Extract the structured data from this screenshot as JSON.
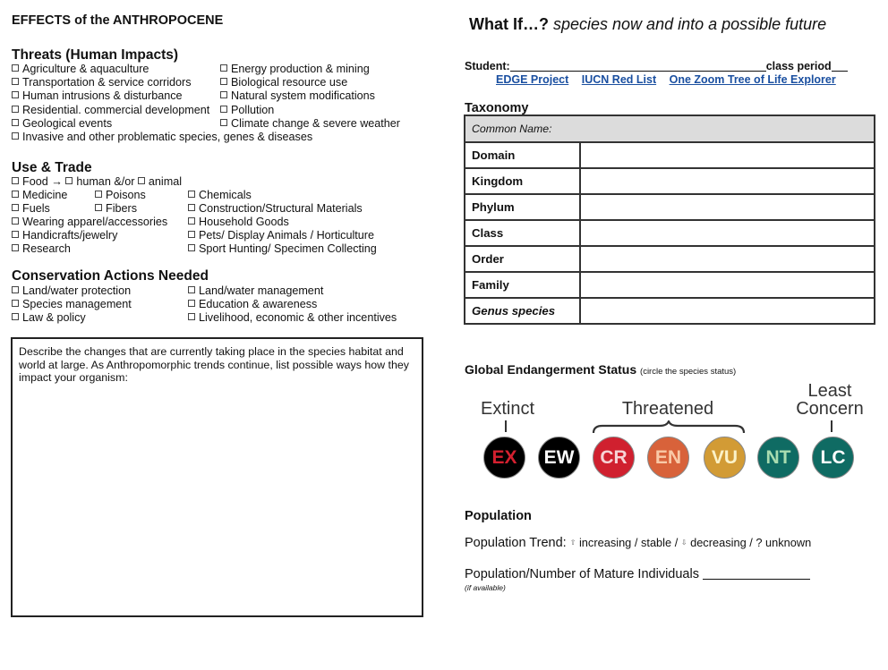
{
  "left": {
    "title": "EFFECTS of the ANTHROPOCENE",
    "threats": {
      "heading": "Threats (Human Impacts)",
      "rows": [
        [
          "Agriculture & aquaculture",
          "Energy production & mining"
        ],
        [
          "Transportation & service corridors",
          "Biological resource use"
        ],
        [
          "Human intrusions & disturbance",
          "Natural system modifications"
        ],
        [
          "Residential. commercial development",
          "Pollution"
        ],
        [
          "Geological events",
          "Climate change & severe weather"
        ],
        [
          "Invasive and other problematic species, genes & diseases"
        ]
      ]
    },
    "use_trade": {
      "heading": "Use & Trade",
      "food": {
        "label": "Food",
        "arrow": "→",
        "human": "human &/or",
        "animal": "animal"
      },
      "rows": [
        [
          "Medicine",
          "Poisons",
          "Chemicals"
        ],
        [
          "Fuels",
          "Fibers",
          "Construction/Structural Materials"
        ],
        [
          "Wearing apparel/accessories",
          "Household Goods"
        ],
        [
          "Handicrafts/jewelry",
          "Pets/ Display Animals / Horticulture"
        ],
        [
          "Research",
          "Sport Hunting/ Specimen Collecting"
        ]
      ]
    },
    "conservation": {
      "heading": "Conservation Actions Needed",
      "rows": [
        [
          "Land/water protection",
          "Land/water management"
        ],
        [
          "Species management",
          "Education & awareness"
        ],
        [
          "Law & policy",
          "Livelihood, economic & other incentives"
        ]
      ]
    },
    "describe_prompt": "Describe the changes that are currently taking place in the species habitat and world at large. As Anthropomorphic trends continue, list possible ways how they impact your organism:"
  },
  "right": {
    "title_bold": "What If…?",
    "title_italic": "species now and into a possible future",
    "student_label": "Student:",
    "class_period_label": "class period",
    "links": [
      "EDGE Project",
      "IUCN Red List",
      "One Zoom Tree of Life Explorer"
    ],
    "link_color": "#1a4fa0",
    "taxonomy": {
      "heading": "Taxonomy",
      "common_name_label": "Common Name:",
      "rows": [
        "Domain",
        "Kingdom",
        "Phylum",
        "Class",
        "Order",
        "Family",
        "Genus species"
      ]
    },
    "status": {
      "heading": "Global Endangerment Status",
      "note": "(circle the species status)",
      "groups": {
        "extinct": "Extinct",
        "threatened": "Threatened",
        "least": "Least",
        "concern": "Concern"
      },
      "codes": [
        {
          "code": "EX",
          "bg": "#000000",
          "fg": "#d4202f"
        },
        {
          "code": "EW",
          "bg": "#000000",
          "fg": "#ffffff"
        },
        {
          "code": "CR",
          "bg": "#d0202f",
          "fg": "#f6d3d6"
        },
        {
          "code": "EN",
          "bg": "#d8623a",
          "fg": "#f9c9a7"
        },
        {
          "code": "VU",
          "bg": "#d29b35",
          "fg": "#fbf2c8"
        },
        {
          "code": "NT",
          "bg": "#0f6b63",
          "fg": "#a9dcb0"
        },
        {
          "code": "LC",
          "bg": "#0f6b63",
          "fg": "#ffffff"
        }
      ]
    },
    "population": {
      "heading": "Population",
      "trend_label": "Population Trend:",
      "increasing": "increasing /",
      "stable": "stable /",
      "decreasing": "decreasing / ? unknown",
      "up_arrow": "⇧",
      "down_arrow": "⇩",
      "mature_label": "Population/Number of Mature Individuals",
      "if_available": "(if available)"
    }
  }
}
